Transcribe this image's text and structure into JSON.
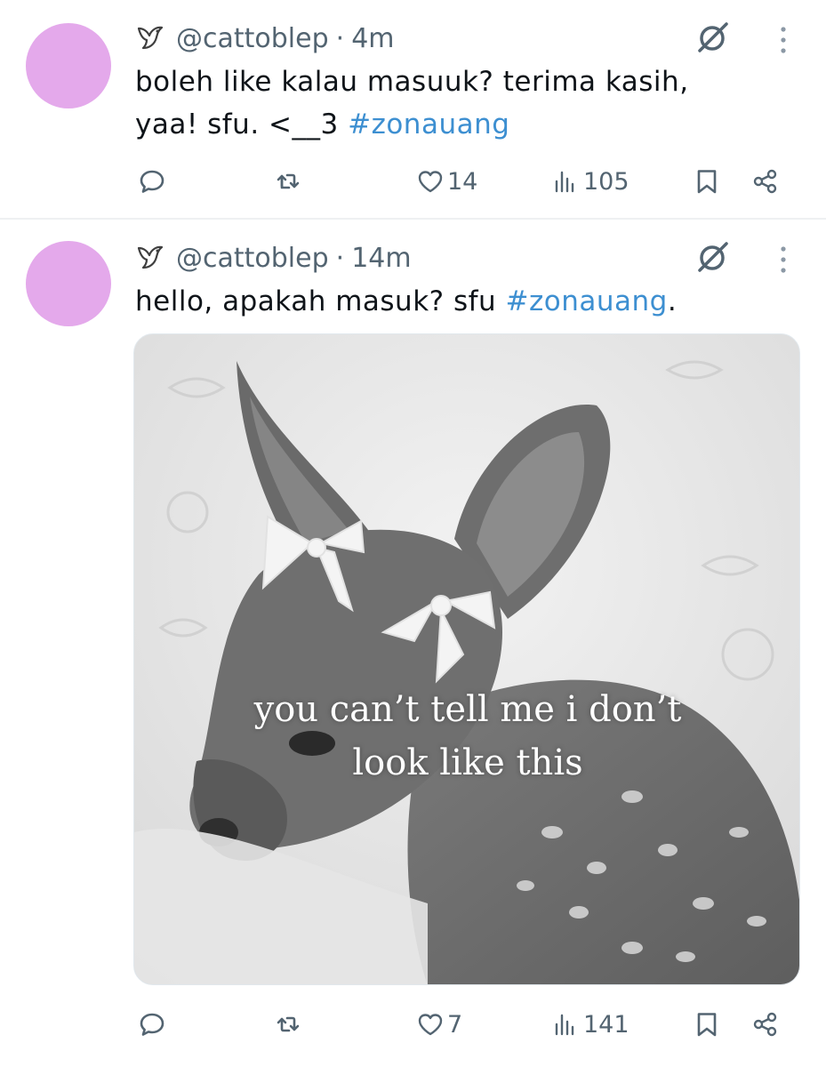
{
  "tweets": [
    {
      "handle": "@cattoblep",
      "separator": "·",
      "time": "4m",
      "text": "boleh like kalau masuuk? terima kasih, yaa! sfu. <__3 ",
      "hashtag": "#zonauang",
      "text_after": "",
      "stats": {
        "likes": "14",
        "views": "105"
      },
      "avatar_color": "#e4a9eb"
    },
    {
      "handle": "@cattoblep",
      "separator": "·",
      "time": "14m",
      "text": "hello, apakah masuk? sfu ",
      "hashtag": "#zonauang",
      "text_after": ".",
      "media": {
        "caption_line1": "you can’t tell me i don’t",
        "caption_line2": "look like this"
      },
      "stats": {
        "likes": "7",
        "views": "141"
      },
      "avatar_color": "#e4a9eb"
    }
  ],
  "icons": [
    "bird-icon",
    "lock-slash-icon",
    "more-vertical-icon",
    "reply-icon",
    "retweet-icon",
    "like-icon",
    "views-icon",
    "bookmark-icon",
    "share-icon"
  ],
  "colors": {
    "hashtag": "#3d8fd1",
    "muted": "#536471",
    "avatar": "#e4a9eb",
    "text": "#0f1419"
  }
}
